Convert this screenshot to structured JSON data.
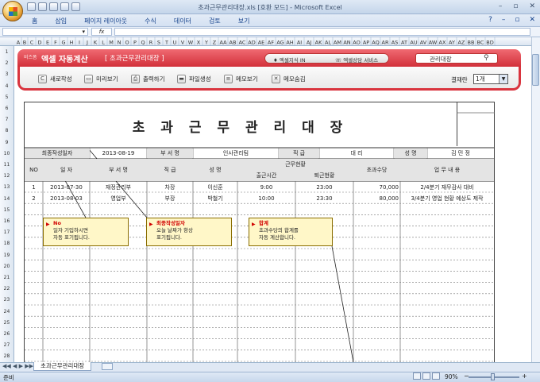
{
  "window": {
    "title": "초과근무관리대장.xls  [호환 모드] - Microsoft Excel"
  },
  "ribbon_tabs": [
    "홈",
    "삽입",
    "페이지 레이아웃",
    "수식",
    "데이터",
    "검토",
    "보기"
  ],
  "formula": {
    "fx": "fx",
    "value": ""
  },
  "column_headers": [
    "A",
    "B",
    "C",
    "D",
    "E",
    "F",
    "G",
    "H",
    "I",
    "J",
    "K",
    "L",
    "M",
    "N",
    "O",
    "P",
    "Q",
    "R",
    "S",
    "T",
    "U",
    "V",
    "W",
    "X",
    "Y",
    "Z",
    "AA",
    "AB",
    "AC",
    "AD",
    "AE",
    "AF",
    "AG",
    "AH",
    "AI",
    "AJ",
    "AK",
    "AL",
    "AM",
    "AN",
    "AO",
    "AP",
    "AQ",
    "AR",
    "AS",
    "AT",
    "AU",
    "AV",
    "AW",
    "AX",
    "AY",
    "AZ",
    "BB",
    "BC",
    "BD"
  ],
  "app": {
    "brand_small": "비즈폼",
    "brand_title": "엑셀 자동계산",
    "subtitle": "[ 초과근무관리대장 ]",
    "nav": [
      "엑셀지식 IN",
      "엑셀상담 서비스"
    ],
    "search_value": "관리대장",
    "toolbar": [
      "새로작성",
      "미리보기",
      "출력하기",
      "파일생성",
      "메모보기",
      "메모숨김"
    ],
    "approval_label": "결재란",
    "approval_value": "1개"
  },
  "document": {
    "title": "초 과 근 무   관 리 대 장",
    "info": {
      "last_date_label": "최종작성일자",
      "last_date": "2013-08-19",
      "dept_label": "부 서 명",
      "dept": "인사관리팀",
      "rank_label": "직   급",
      "rank": "대   리",
      "name_label": "성   명",
      "name": "김 민 정"
    },
    "headers": {
      "no": "NO",
      "date": "일   자",
      "dept": "부 서 명",
      "rank": "직   급",
      "name": "성   명",
      "overtime": "근무현황",
      "start": "출근시간",
      "end": "퇴근현황",
      "pay": "초과수당",
      "task": "업 무 내 용"
    },
    "rows": [
      {
        "no": "1",
        "date": "2013-07-30",
        "dept": "재정관리부",
        "rank": "차장",
        "name": "이신훈",
        "start": "9:00",
        "end": "23:00",
        "pay": "70,000",
        "task": "2/4분기 재무감사 대비"
      },
      {
        "no": "2",
        "date": "2013-08-03",
        "dept": "영업부",
        "rank": "부장",
        "name": "박철기",
        "start": "10:00",
        "end": "23:30",
        "pay": "80,000",
        "task": "3/4분기 영업 현황 예상도 제작"
      }
    ]
  },
  "notes": [
    {
      "title": "No",
      "line1": "일자 기입하시면",
      "line2": "자동 표기됩니다."
    },
    {
      "title": "최종작성일자",
      "line1": "오늘 날짜가 항상",
      "line2": "표기됩니다."
    },
    {
      "title": "합계",
      "line1": "초과수당의 합계를",
      "line2": "자동 계산합니다."
    }
  ],
  "sheet_tab": "초과근무관리대장",
  "status": {
    "ready": "준비",
    "zoom": "90%"
  }
}
